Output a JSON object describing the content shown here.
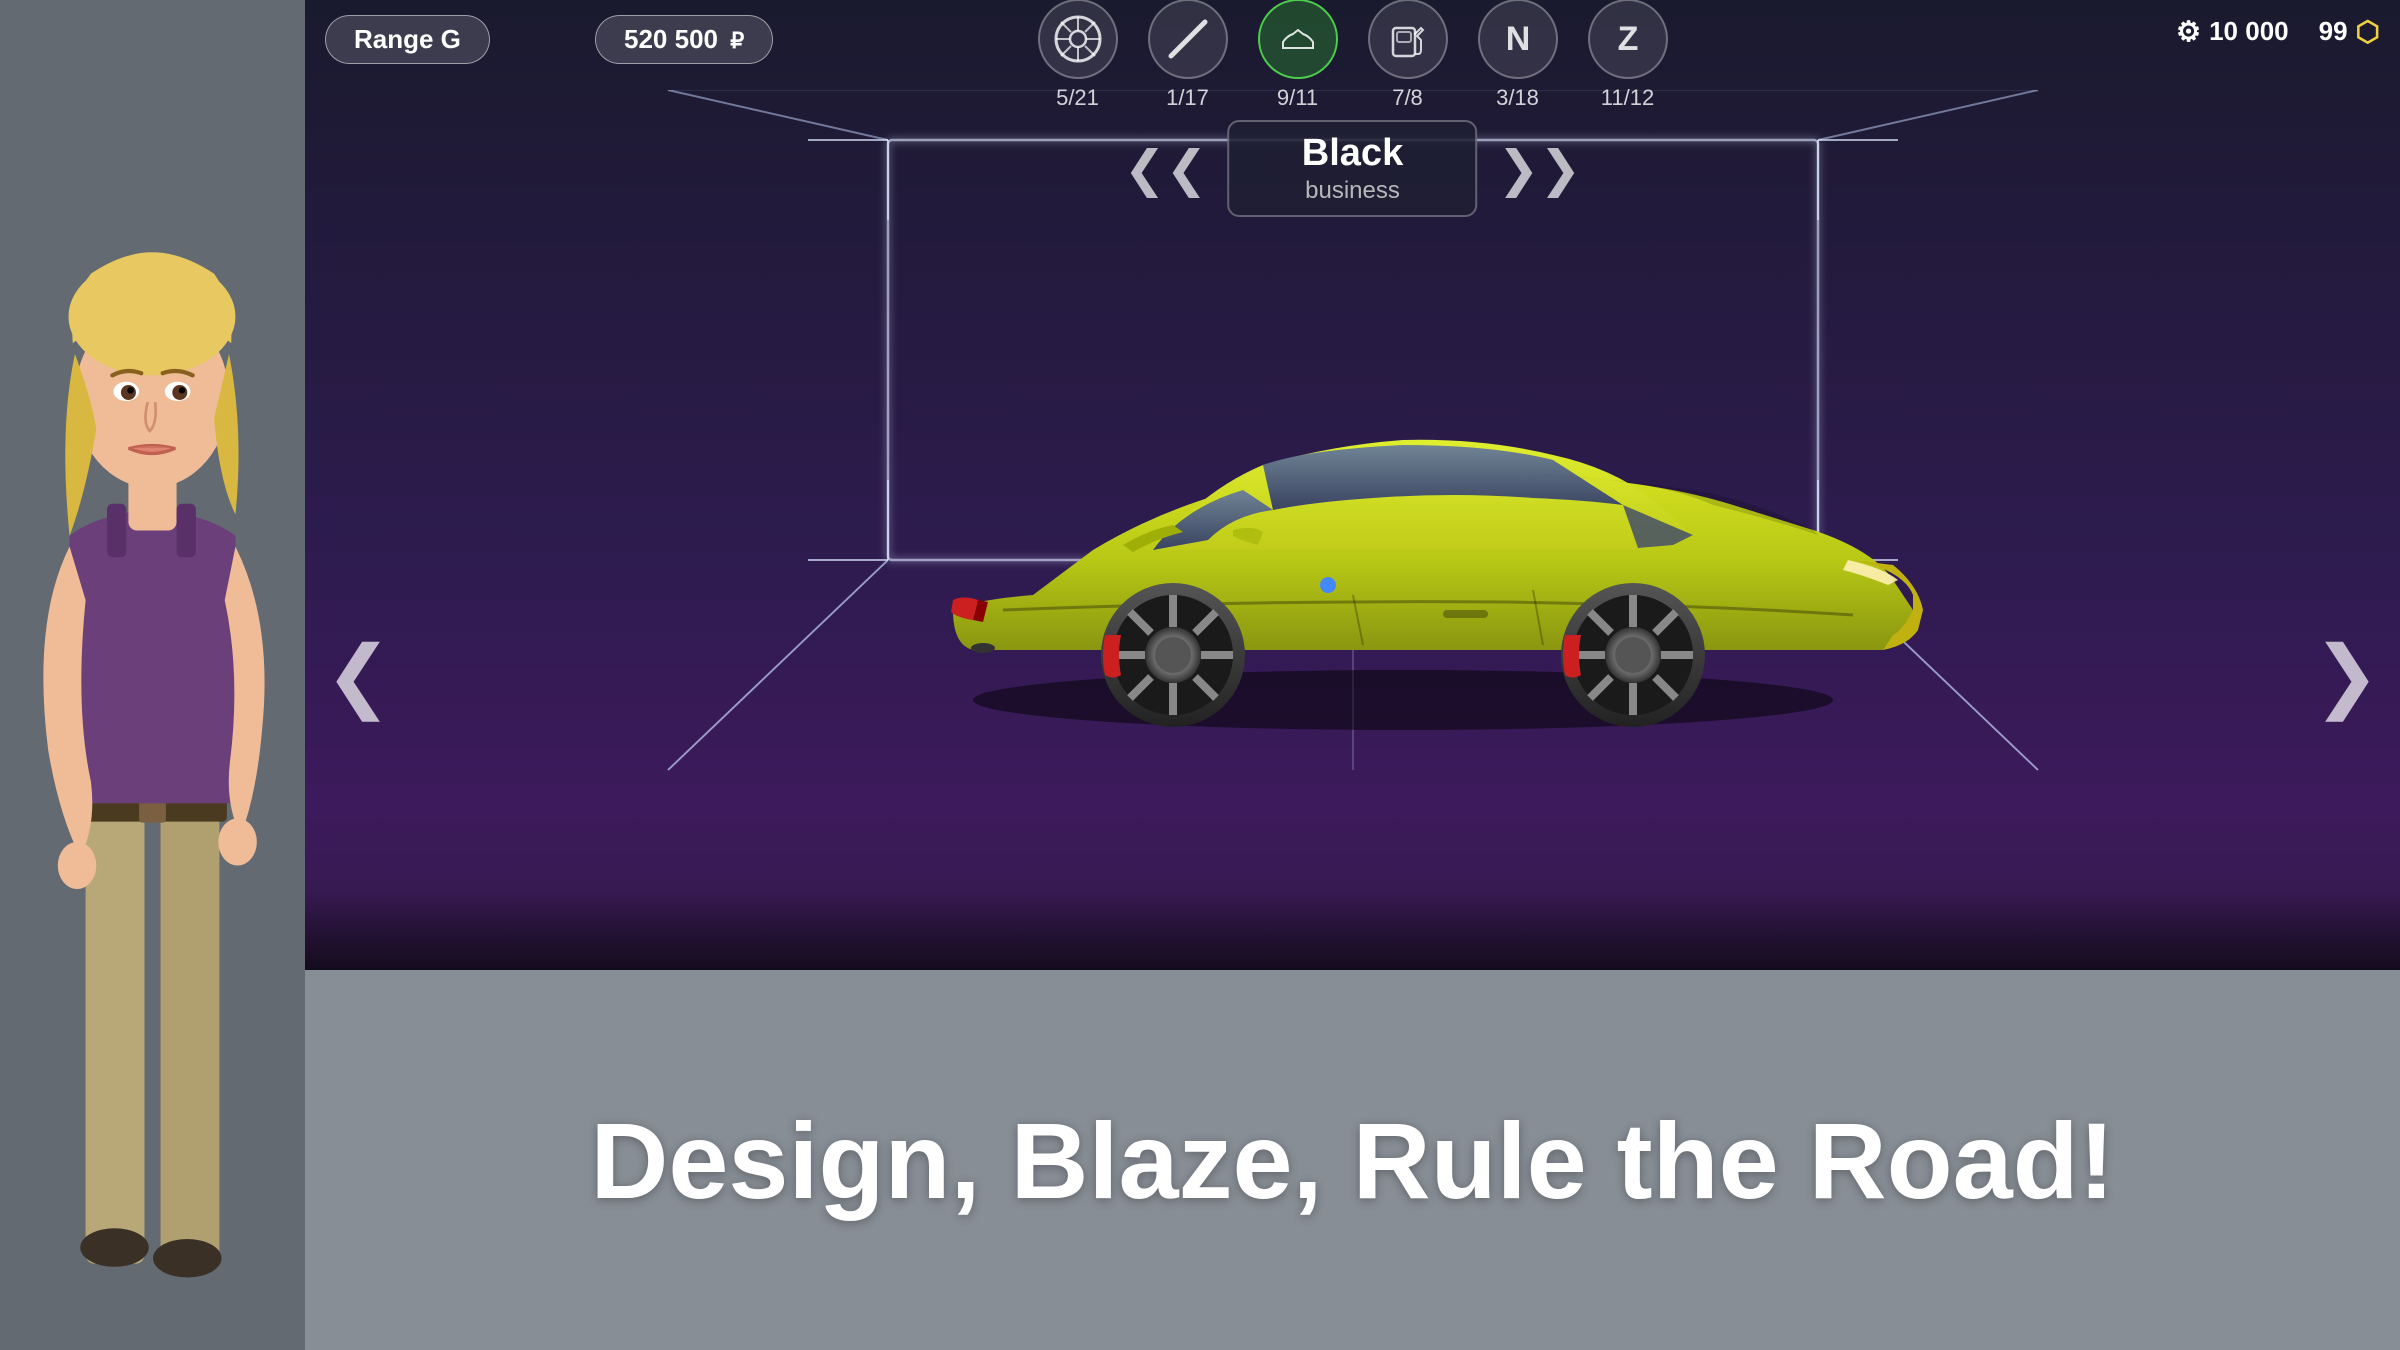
{
  "header": {
    "range_label": "Range G",
    "price": "520 500",
    "currency_symbol": "₽"
  },
  "icons": [
    {
      "id": "wheels",
      "symbol": "⊙",
      "label": "5/21",
      "active": false
    },
    {
      "id": "stripe",
      "symbol": "╲",
      "label": "1/17",
      "active": false
    },
    {
      "id": "body",
      "symbol": "⬡",
      "label": "9/11",
      "active": true
    },
    {
      "id": "gas",
      "symbol": "⛽",
      "label": "7/8",
      "active": false
    },
    {
      "id": "n-badge",
      "symbol": "N",
      "label": "3/18",
      "active": false
    },
    {
      "id": "z-badge",
      "symbol": "Z",
      "label": "11/12",
      "active": false
    }
  ],
  "resources": {
    "coins": "10 000",
    "gems": "99"
  },
  "color": {
    "name": "Black",
    "type": "business"
  },
  "arrows": {
    "left": "‹",
    "right": "›",
    "nav_left": "‹",
    "nav_right": "›"
  },
  "tagline": "Design, Blaze, Rule the Road!"
}
